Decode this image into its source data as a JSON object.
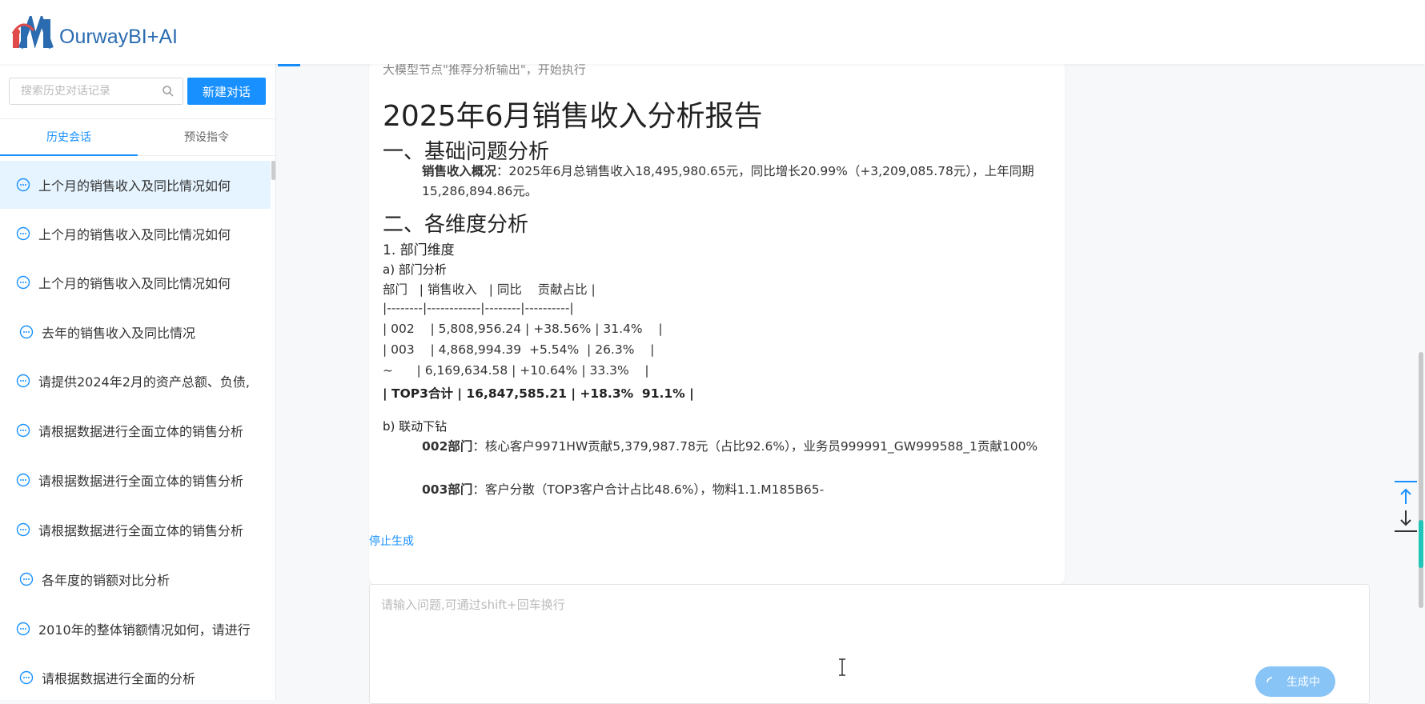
{
  "brand": {
    "name": "OurwayBI+AI"
  },
  "sidebar": {
    "search_placeholder": "搜索历史对话记录",
    "new_chat_label": "新建对话",
    "tabs": [
      {
        "label": "历史会话",
        "active": true
      },
      {
        "label": "预设指令",
        "active": false
      }
    ],
    "history": [
      {
        "label": "上个月的销售收入及同比情况如何",
        "active": true
      },
      {
        "label": "上个月的销售收入及同比情况如何",
        "active": false
      },
      {
        "label": "上个月的销售收入及同比情况如何",
        "active": false
      },
      {
        "label": "去年的销售收入及同比情况",
        "active": false
      },
      {
        "label": "请提供2024年2月的资产总额、负债,",
        "active": false
      },
      {
        "label": "请根据数据进行全面立体的销售分析",
        "active": false
      },
      {
        "label": "请根据数据进行全面立体的销售分析",
        "active": false
      },
      {
        "label": "请根据数据进行全面立体的销售分析",
        "active": false
      },
      {
        "label": "各年度的销额对比分析",
        "active": false
      },
      {
        "label": "2010年的整体销额情况如何，请进行",
        "active": false
      },
      {
        "label": "请根据数据进行全面的分析",
        "active": false
      }
    ]
  },
  "report": {
    "node_msg": "大模型节点\"推荐分析输出\"，开始执行",
    "title": "2025年6月销售收入分析报告",
    "section1": "一、基础问题分析",
    "overview_label": "销售收入概况",
    "overview_text": "：2025年6月总销售收入18,495,980.65元，同比增长20.99%（+3,209,085.78元），上年同期15,286,894.86元。",
    "section2": "二、各维度分析",
    "dim1": "1. 部门维度",
    "sub_a": "a) 部门分析",
    "table_rows": [
      "部门   | 销售收入   | 同比    贡献占比 |",
      "|--------|------------|--------|----------|",
      "| 002    | 5,808,956.24 | +38.56% | 31.4%    |",
      "| 003    | 4,868,994.39  +5.54%  | 26.3%    |",
      "~      | 6,169,634.58 | +10.64% | 33.3%    |"
    ],
    "table_total": "| TOP3合计 | 16,847,585.21 | +18.3%  91.1% |",
    "sub_b": "b) 联动下钻",
    "drill_002_label": "002部门",
    "drill_002_text": "：核心客户9971HW贡献5,379,987.78元（占比92.6%），业务员999991_GW999588_1贡献100%",
    "drill_003_label": "003部门",
    "drill_003_text": "：客户分散（TOP3客户合计占比48.6%），物料1.1.M185B65-"
  },
  "stop_label": "停止生成",
  "input": {
    "placeholder": "请输入问题,可通过shift+回车换行",
    "generating_label": "生成中"
  },
  "colors": {
    "accent": "#1890ff",
    "brand": "#2b6cb0",
    "scroll_thumb": "#20c4b8"
  }
}
